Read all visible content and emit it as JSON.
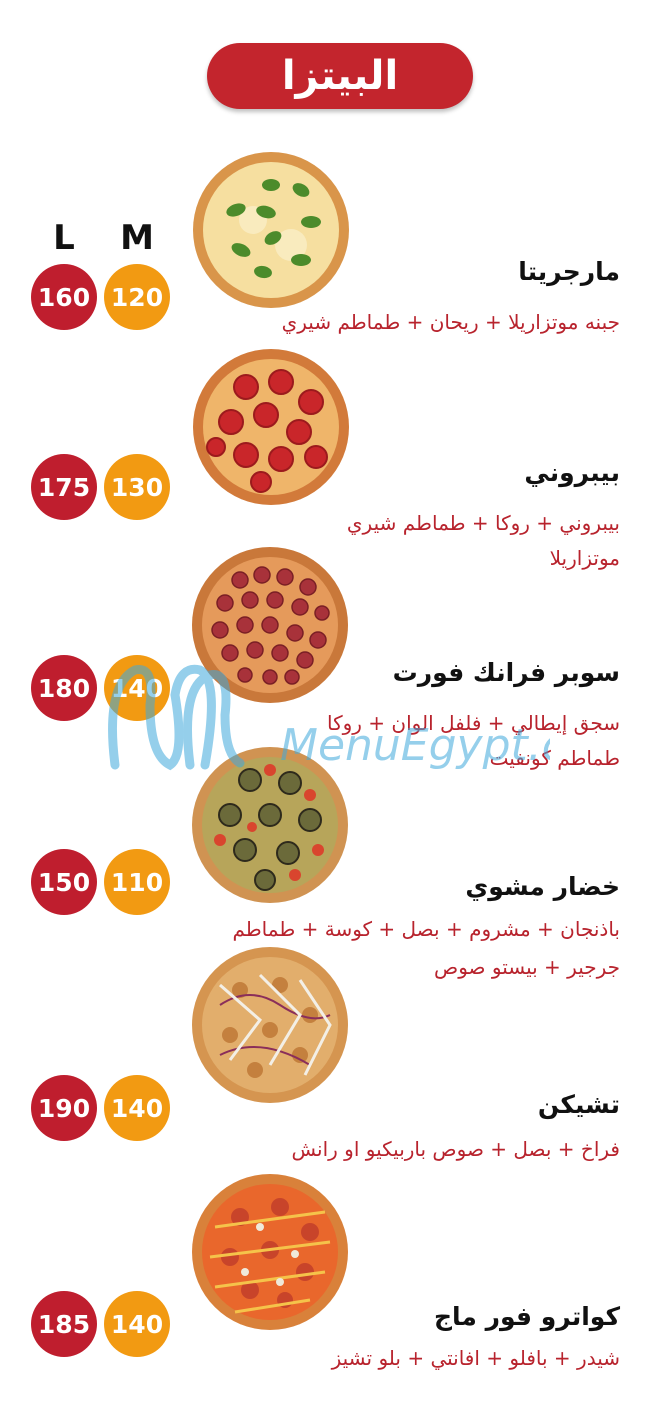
{
  "header": {
    "title": "البيتزا"
  },
  "size_labels": {
    "large": "L",
    "medium": "M"
  },
  "items": [
    {
      "name": "مارجريتا",
      "desc_lines": [
        "جبنه موتزاريلا + ريحان + طماطم شيري"
      ],
      "price_m": "120",
      "price_l": "160",
      "image": "margherita-pizza"
    },
    {
      "name": "بيبروني",
      "desc_lines": [
        "بيبروني + روكا + طماطم شيري",
        "موتزاريلا"
      ],
      "price_m": "130",
      "price_l": "175",
      "image": "pepperoni-pizza"
    },
    {
      "name": "سوبر فرانك فورت",
      "desc_lines": [
        "سجق إيطالي + فلفل الوان + روكا",
        "طماطم كونفيت"
      ],
      "price_m": "140",
      "price_l": "180",
      "image": "sausage-pizza"
    },
    {
      "name": "خضار مشوي",
      "desc_lines": [
        "باذنجان + مشروم + بصل + كوسة + طماطم",
        "جرجير + بيستو صوص"
      ],
      "price_m": "110",
      "price_l": "150",
      "image": "grilled-vegetable-pizza"
    },
    {
      "name": "تشيكن",
      "desc_lines": [
        "فراخ  + بصل + صوص باربيكيو او رانش"
      ],
      "price_m": "140",
      "price_l": "190",
      "image": "chicken-pizza"
    },
    {
      "name": "كواترو فور ماج",
      "desc_lines": [
        "شيدر + بافلو + افانتي + بلو تشيز"
      ],
      "price_m": "140",
      "price_l": "185",
      "image": "quattro-formaggi-pizza"
    }
  ],
  "watermark": {
    "text": "MenuEgypt.com"
  },
  "colors": {
    "title_bg": "#c3252d",
    "price_l": "#bf1e2e",
    "price_m": "#f29a12",
    "desc": "#b8232d"
  }
}
